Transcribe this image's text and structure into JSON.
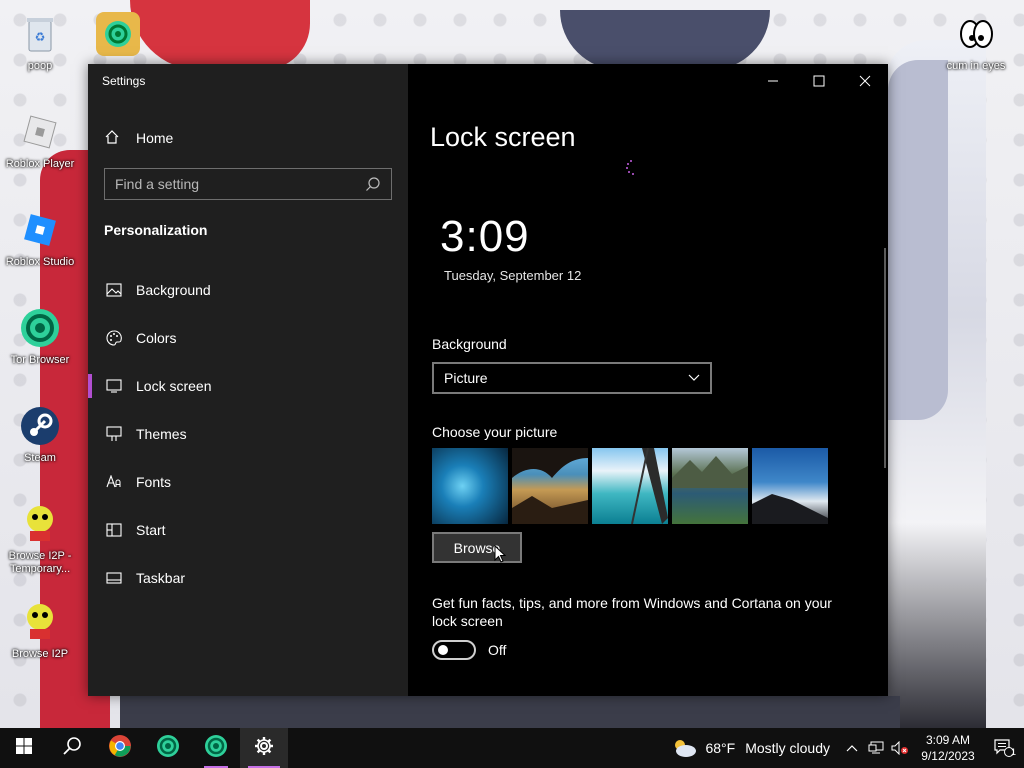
{
  "desktop": {
    "icons": [
      {
        "label": "poop",
        "icon": "recycle-bin-icon"
      },
      {
        "label": "Tor Browser",
        "icon": "tor-browser-icon"
      },
      {
        "label": "Roblox Player",
        "icon": "roblox-player-icon"
      },
      {
        "label": "Roblox Studio",
        "icon": "roblox-studio-icon"
      },
      {
        "label": "Tor Browser",
        "icon": "tor-browser-icon"
      },
      {
        "label": "Steam",
        "icon": "steam-icon"
      },
      {
        "label": "Browse I2P - Temporary...",
        "icon": "i2p-icon"
      },
      {
        "label": "Browse I2P",
        "icon": "i2p-icon"
      },
      {
        "label": "cum in eyes",
        "icon": "cartoon-eyes-icon"
      }
    ]
  },
  "window": {
    "title": "Settings",
    "controls": {
      "minimize": "—",
      "maximize": "☐",
      "close": "✕"
    }
  },
  "nav": {
    "home": "Home",
    "search_placeholder": "Find a setting",
    "section": "Personalization",
    "items": [
      {
        "label": "Background",
        "icon": "background-image-icon"
      },
      {
        "label": "Colors",
        "icon": "palette-icon"
      },
      {
        "label": "Lock screen",
        "icon": "lock-screen-icon",
        "active": true
      },
      {
        "label": "Themes",
        "icon": "themes-brush-icon"
      },
      {
        "label": "Fonts",
        "icon": "fonts-icon"
      },
      {
        "label": "Start",
        "icon": "start-menu-icon"
      },
      {
        "label": "Taskbar",
        "icon": "taskbar-icon"
      }
    ]
  },
  "content": {
    "title": "Lock screen",
    "preview_time": "3:09",
    "preview_date": "Tuesday, September 12",
    "background_label": "Background",
    "background_value": "Picture",
    "choose_picture_label": "Choose your picture",
    "browse_label": "Browse",
    "facts_text": "Get fun facts, tips, and more from Windows and Cortana on your lock screen",
    "toggle_state": "Off"
  },
  "taskbar": {
    "apps": [
      "start-icon",
      "search-icon",
      "chrome-icon",
      "tor-browser-icon",
      "tor-browser-icon",
      "settings-gear-icon"
    ],
    "weather_temp": "68°F",
    "weather_text": "Mostly cloudy",
    "time": "3:09 AM",
    "date": "9/12/2023",
    "notification_count": "1"
  },
  "colors": {
    "accent": "#b24fd1",
    "window_bg": "#000000",
    "nav_bg": "#1f1f1f",
    "taskbar_bg": "#101010"
  }
}
